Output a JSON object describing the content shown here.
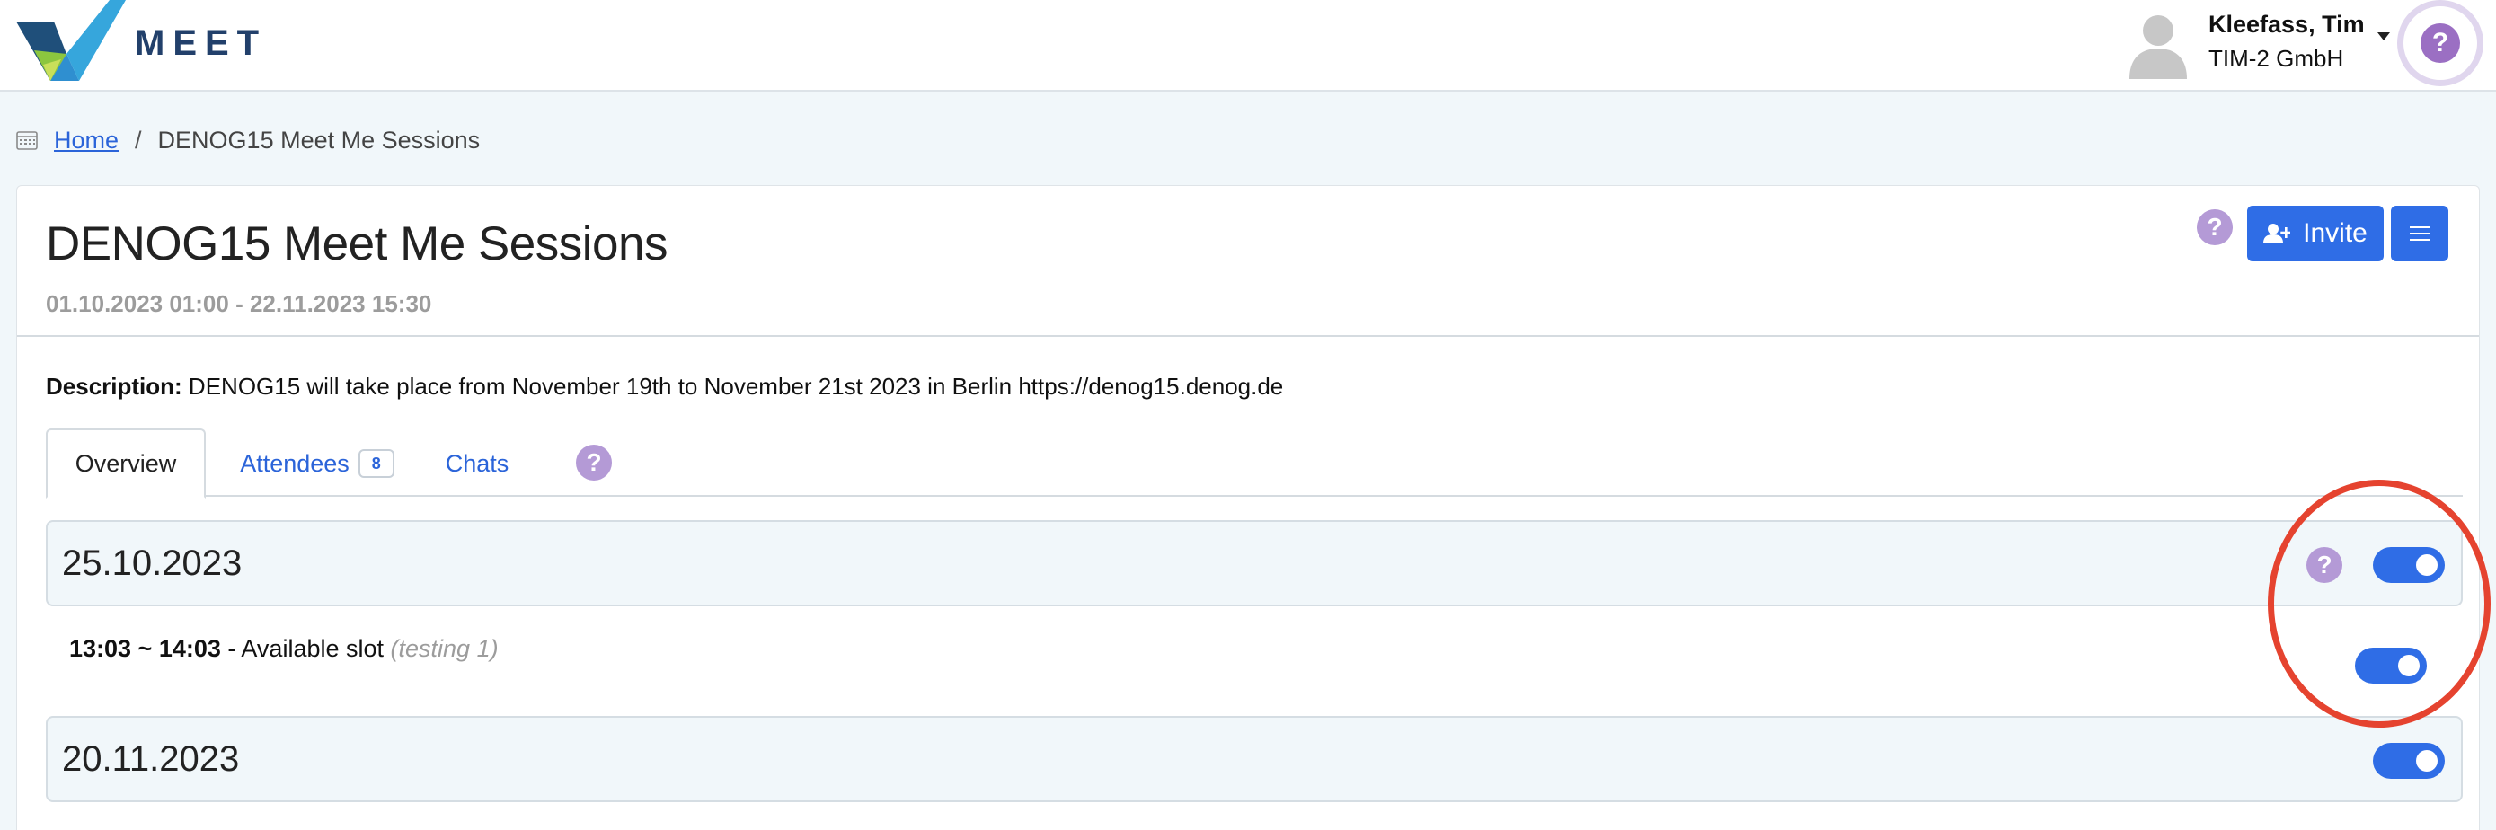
{
  "app": {
    "brand": "MEET"
  },
  "user": {
    "name": "Kleefass, Tim",
    "org": "TIM-2 GmbH"
  },
  "icons": {
    "help": "?",
    "logo": "meet-logo-icon",
    "avatar": "user-avatar-icon",
    "calendar": "calendar-icon",
    "add_user": "add-user-icon",
    "menu": "hamburger-menu-icon"
  },
  "breadcrumb": {
    "home": "Home",
    "separator": "/",
    "current": "DENOG15 Meet Me Sessions"
  },
  "event": {
    "title": "DENOG15 Meet Me Sessions",
    "date_range": "01.10.2023 01:00 - 22.11.2023 15:30",
    "description_label": "Description:",
    "description_text": "DENOG15 will take place from November 19th to November 21st 2023 in Berlin https://denog15.denog.de"
  },
  "actions": {
    "invite_label": "Invite"
  },
  "tabs": [
    {
      "label": "Overview",
      "active": true
    },
    {
      "label": "Attendees",
      "badge": "8"
    },
    {
      "label": "Chats"
    }
  ],
  "schedule": [
    {
      "date": "25.10.2023",
      "enabled": true,
      "slots": [
        {
          "time": "13:03 ~ 14:03",
          "separator": " - ",
          "label": "Available slot",
          "note": "(testing 1)",
          "enabled": true
        }
      ]
    },
    {
      "date": "20.11.2023",
      "enabled": true,
      "slots": []
    }
  ],
  "colors": {
    "primary": "#2f6de6",
    "help": "#b49ad6",
    "link": "#2b64d9",
    "annotation": "#e5432f",
    "brand": "#22406b"
  }
}
